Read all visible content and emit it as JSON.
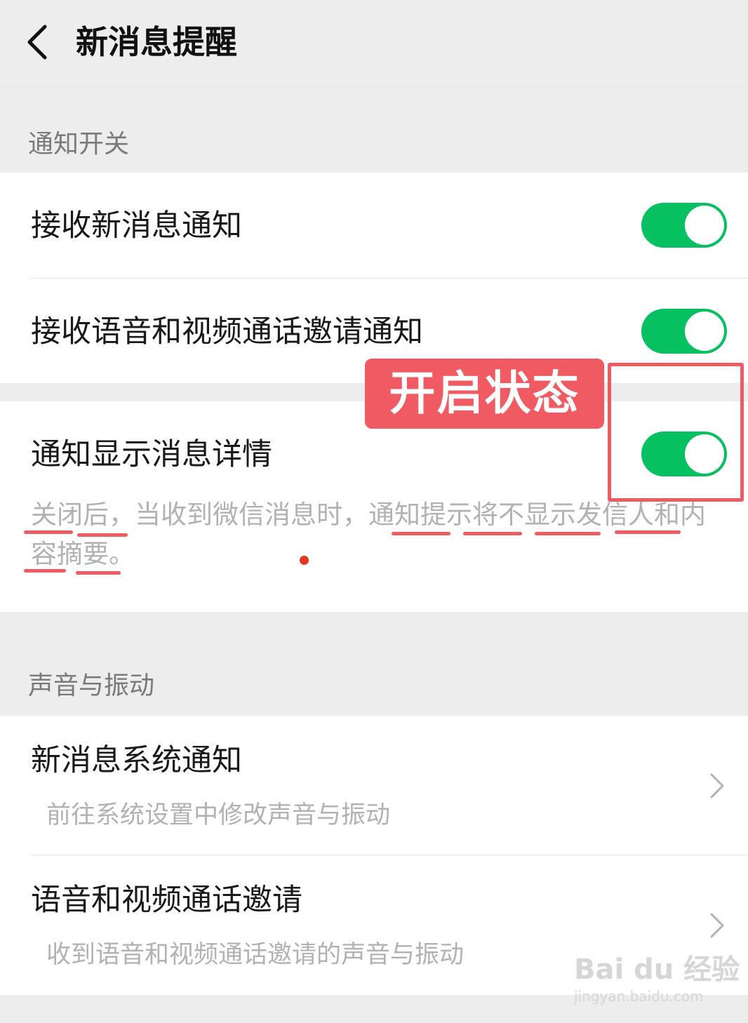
{
  "header": {
    "title": "新消息提醒",
    "back_icon": "chevron-left-icon"
  },
  "notification_section": {
    "label": "通知开关",
    "receive_new_message": {
      "label": "接收新消息通知",
      "enabled": true
    },
    "receive_call_invite": {
      "label": "接收语音和视频通话邀请通知",
      "enabled": true
    }
  },
  "detail_section": {
    "show_details": {
      "label": "通知显示消息详情",
      "enabled": true,
      "description": "关闭后，当收到微信消息时，通知提示将不显示发信人和内容摘要。"
    }
  },
  "sound_section": {
    "label": "声音与振动",
    "system_notification": {
      "title": "新消息系统通知",
      "subtitle": "前往系统设置中修改声音与振动"
    },
    "call_invite_sound": {
      "title": "语音和视频通话邀请",
      "subtitle": "收到语音和视频通话邀请的声音与振动"
    }
  },
  "annotation": {
    "badge_text": "开启状态",
    "color": "#ee5b62"
  },
  "watermark": {
    "main": "Bai du 经验",
    "sub": "jingyan.baidu.com"
  },
  "colors": {
    "toggle_on": "#07c160",
    "background": "#ededed",
    "accent_red": "#ee5b62"
  }
}
